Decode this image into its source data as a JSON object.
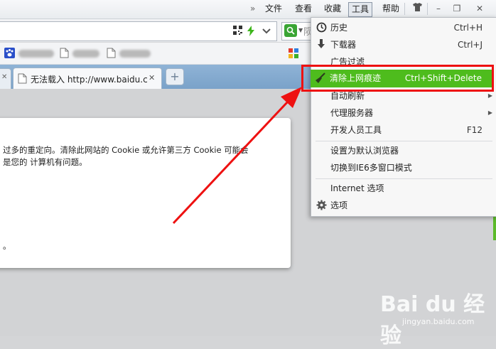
{
  "menubar": {
    "overflow": "»",
    "items": [
      "文件",
      "查看",
      "收藏",
      "工具",
      "帮助"
    ],
    "active_item": "工具",
    "shirt_icon": "shirt-icon",
    "minimize": "–",
    "restore": "❐",
    "close": "✕"
  },
  "addressbar": {
    "search_partial": "陨"
  },
  "tabs": {
    "active_title": "无法载入 http://www.baidu.c",
    "close": "✕",
    "new_tab": "+"
  },
  "error_page": {
    "line1": "过多的重定向。清除此网站的 Cookie 或允许第三方 Cookie 可能会",
    "line2": "是您的 计算机有问题。",
    "line3": "。"
  },
  "dropdown": {
    "items": [
      {
        "label": "历史",
        "shortcut": "Ctrl+H",
        "icon": "history-clock-icon"
      },
      {
        "label": "下载器",
        "shortcut": "Ctrl+J",
        "icon": "download-arrow-icon"
      },
      {
        "label": "广告过滤",
        "shortcut": "",
        "icon": ""
      },
      {
        "label": "清除上网痕迹",
        "shortcut": "Ctrl+Shift+Delete",
        "icon": "broom-icon"
      },
      {
        "label": "自动刷新",
        "shortcut": "",
        "icon": ""
      },
      {
        "label": "代理服务器",
        "shortcut": "",
        "icon": ""
      },
      {
        "label": "开发人员工具",
        "shortcut": "F12",
        "icon": ""
      },
      {
        "label": "设置为默认浏览器",
        "shortcut": "",
        "icon": ""
      },
      {
        "label": "切换到IE6多窗口模式",
        "shortcut": "",
        "icon": ""
      },
      {
        "label": "Internet 选项",
        "shortcut": "",
        "icon": ""
      },
      {
        "label": "选项",
        "shortcut": "",
        "icon": "gear-icon"
      }
    ],
    "highlighted": "清除上网痕迹"
  },
  "watermark": {
    "brand": "Bai du 经验",
    "url": "jingyan.baidu.com"
  },
  "colors": {
    "highlight": "#4ebc1d",
    "annotation": "#ee1111",
    "tabbar": "#7aa2c9"
  }
}
